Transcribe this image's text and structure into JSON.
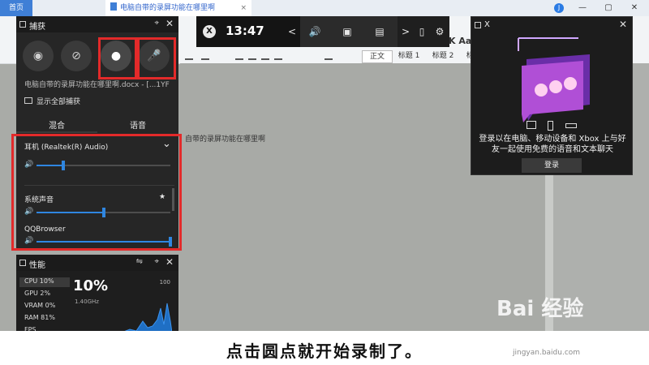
{
  "doc_app": {
    "home_tab": "首页",
    "doc_tab": "电脑自带的录屏功能在哪里啊",
    "tab_close": "×",
    "user_initial": "J",
    "win_min": "—",
    "win_max": "▢",
    "win_close": "✕",
    "ribbon_aa": "K Aa",
    "styles": [
      "正文",
      "标题 1",
      "标题 2",
      "标题 3"
    ],
    "page_text": "自带的录屏功能在哪里啊"
  },
  "gamebar": {
    "xbox_icon": "xbox-logo-icon",
    "clock": "13:47",
    "prev": "<",
    "next": ">",
    "volume": "🔊",
    "capture": "▣",
    "performance": "▤",
    "mouse": "▯",
    "settings": "⚙"
  },
  "capture": {
    "title": "捕获",
    "pin": "⌖",
    "close": "✕",
    "screenshot_icon": "◉",
    "record_last_icon": "⊘",
    "record_icon": "●",
    "mic_icon": "🎤",
    "file_name": "电脑自带的录屏功能在哪里啊.docx - [...1YF",
    "show_all": "显示全部捕获"
  },
  "audio": {
    "tabs": [
      "混合",
      "语音"
    ],
    "device": "耳机 (Realtek(R) Audio)",
    "device_chevron": "⌄",
    "system_sound": "系统声音",
    "system_star": "★",
    "app": "QQBrowser",
    "speaker": "🔊",
    "levels": {
      "device": 0.2,
      "system": 0.5,
      "app": 1.0
    }
  },
  "performance": {
    "title": "性能",
    "settings": "⇋",
    "pin": "⌖",
    "close": "✕",
    "rows": [
      "CPU  10%",
      "GPU   2%",
      "VRAM   0%",
      "RAM  81%",
      "FPS"
    ],
    "big_value": "10%",
    "frequency": "1.40GHz",
    "max": "100"
  },
  "social": {
    "title": "X",
    "close": "✕",
    "message": "登录以在电脑、移动设备和 Xbox 上与好友一起使用免费的语音和文本聊天",
    "login": "登录"
  },
  "caption": "点击圆点就开始录制了。",
  "watermark": {
    "brand": "Bai 经验",
    "url": "jingyan.baidu.com"
  },
  "colors": {
    "accent": "#2f86e0",
    "highlight": "#e32a2a",
    "panel": "#262626"
  }
}
